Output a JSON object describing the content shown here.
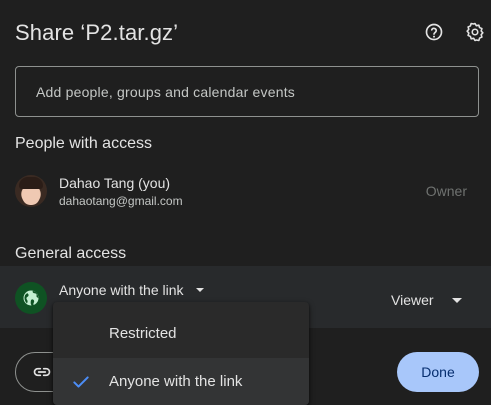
{
  "dialog": {
    "title": "Share ‘P2.tar.gz’",
    "icons": {
      "help": "help-circle-icon",
      "settings": "gear-icon"
    }
  },
  "add_people": {
    "placeholder": "Add people, groups and calendar events"
  },
  "people_with_access": {
    "title": "People with access",
    "people": [
      {
        "name": "Dahao Tang (you)",
        "email": "dahaotang@gmail.com",
        "role": "Owner",
        "avatar": "user-photo-avatar"
      }
    ]
  },
  "general_access": {
    "title": "General access",
    "icon": "globe-icon",
    "selected": "Anyone with the link",
    "role": "Viewer",
    "options": [
      "Restricted",
      "Anyone with the link"
    ],
    "checked_option": "Anyone with the link"
  },
  "footer": {
    "copy_link_icon": "link-icon",
    "done_label": "Done"
  },
  "colors": {
    "background": "#1f1f1f",
    "row_highlight": "#282a2c",
    "menu_background": "#2a2a2a",
    "primary_button": "#a8c7fa",
    "check_accent": "#4c8df6",
    "globe_background": "#0f5223"
  }
}
